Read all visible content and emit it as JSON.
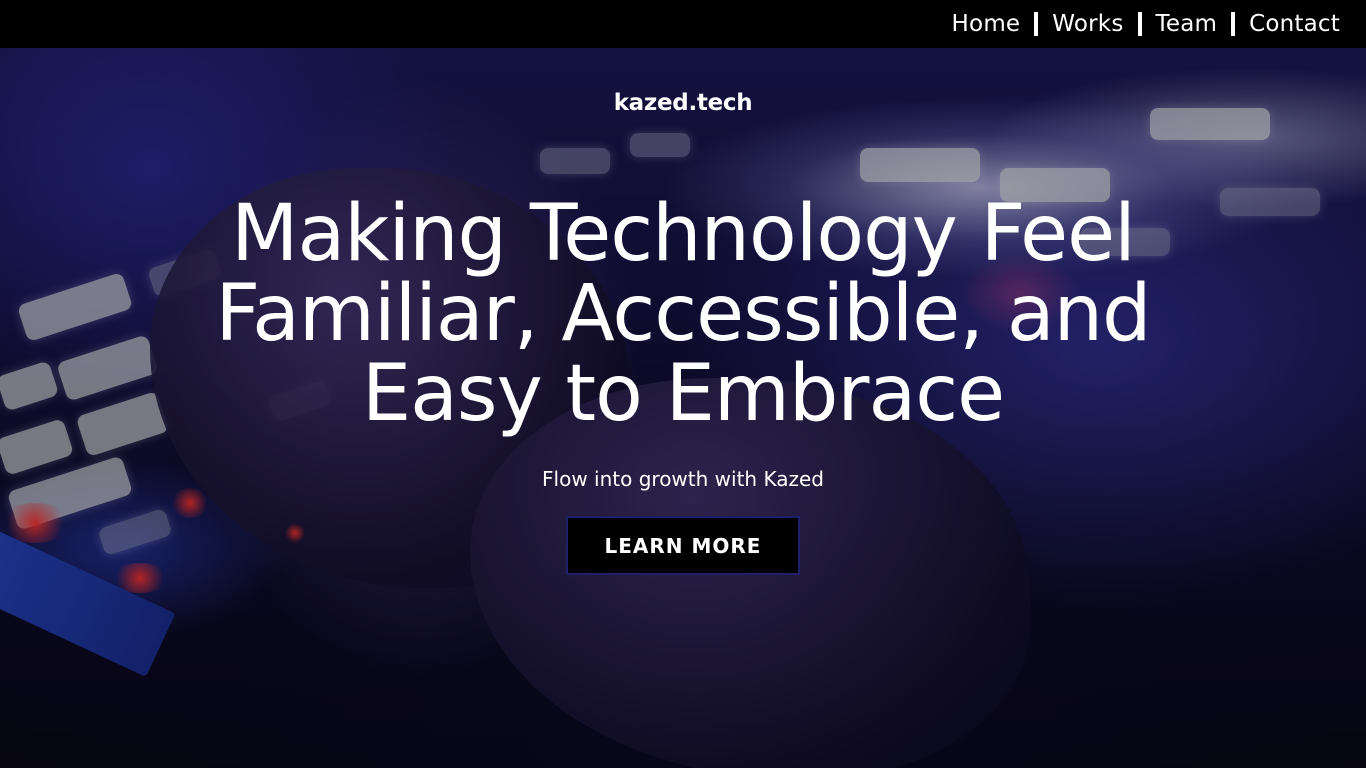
{
  "nav": {
    "items": [
      {
        "label": "Home"
      },
      {
        "label": "Works"
      },
      {
        "label": "Team"
      },
      {
        "label": "Contact"
      }
    ]
  },
  "hero": {
    "logo": "kazed.tech",
    "headline": "Making Technology Feel Familiar, Accessible, and Easy to Embrace",
    "tagline": "Flow into growth with Kazed",
    "cta_label": "LEARN MORE"
  },
  "colors": {
    "topbar": "#000000",
    "text": "#ffffff",
    "cta_background": "#000000",
    "cta_border": "#20206a"
  }
}
